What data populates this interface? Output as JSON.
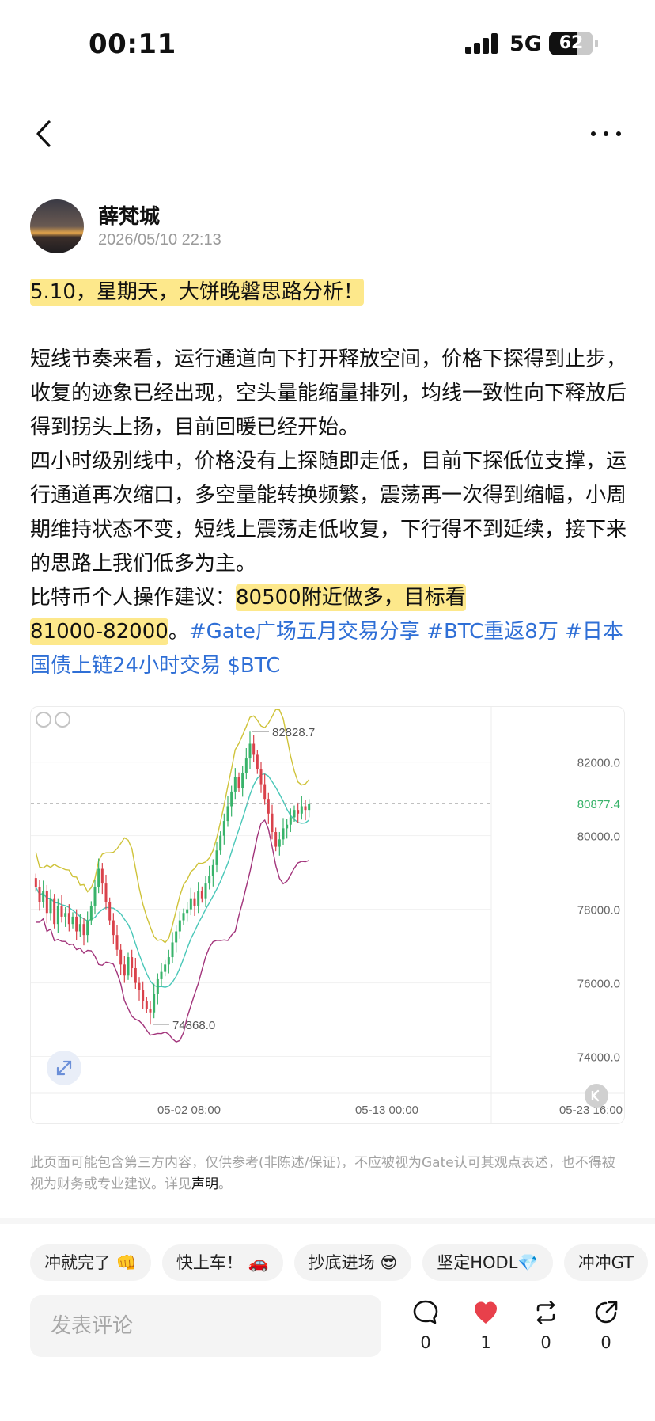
{
  "status": {
    "time": "00:11",
    "network": "5G",
    "battery": "62",
    "battery_level": 0.62
  },
  "post": {
    "author": "薛梵城",
    "timestamp": "2026/05/10 22:13",
    "title": "5.10，星期天，大饼晚磐思路分析！",
    "para1": "短线节奏来看，运行通道向下打开释放空间，价格下探得到止步，收复的迹象已经出现，空头量能缩量排列，均线一致性向下释放后得到拐头上扬，目前回暖已经开始。",
    "para2": "四小时级别线中，价格没有上探随即走低，目前下探低位支撑，运行通道再次缩口，多空量能转换频繁，震荡再一次得到缩幅，小周期维持状态不变，短线上震荡走低收复，下行得不到延续，接下来的思路上我们低多为主。",
    "advice_prefix": "比特币个人操作建议：",
    "advice_highlight1": "80500附近做多，目标看",
    "advice_highlight2": "81000-82000",
    "advice_end": "。",
    "tags": [
      "#Gate广场五月交易分享",
      "#BTC重返8万",
      "#日本国债上链24小时交易",
      "$BTC"
    ]
  },
  "chart_data": {
    "type": "candlestick",
    "x_tick_labels": [
      "05-02 08:00",
      "05-13 00:00",
      "05-23 16:00"
    ],
    "y_tick_labels": [
      "82000.0",
      "80000.0",
      "78000.0",
      "76000.0",
      "74000.0"
    ],
    "ylim": [
      73000,
      83500
    ],
    "current_price": "80877.4",
    "high_label": "82828.7",
    "low_label": "74868.0",
    "high_value": 82828.7,
    "low_value": 74868.0,
    "current_value": 80877.4,
    "grid": true,
    "colors": {
      "up": "#38b36a",
      "down": "#d9424b",
      "upper_band": "#cfc33a",
      "mid_band": "#49c7b8",
      "lower_band": "#a2347b"
    },
    "closes": [
      78600,
      78200,
      78500,
      77900,
      78300,
      77600,
      78100,
      77800,
      77900,
      77600,
      77800,
      77400,
      77600,
      77300,
      77700,
      78100,
      78600,
      79100,
      78700,
      78200,
      77700,
      77300,
      76900,
      76500,
      76200,
      76700,
      76400,
      76000,
      75800,
      75500,
      75300,
      75200,
      75700,
      76100,
      76300,
      76500,
      76700,
      77100,
      77400,
      77700,
      77900,
      78000,
      78300,
      78100,
      78500,
      78300,
      78700,
      78900,
      79200,
      79600,
      80000,
      80400,
      80800,
      81200,
      81600,
      81300,
      81700,
      82100,
      82500,
      82200,
      81800,
      81400,
      81000,
      80600,
      80100,
      79700,
      79900,
      80200,
      80300,
      80500,
      80700,
      80600,
      80800,
      80700,
      80877
    ]
  },
  "disclaimer": {
    "text": "此页面可能包含第三方内容，仅供参考(非陈述/保证)，不应被视为Gate认可其观点表述，也不得被视为财务或专业建议。详见",
    "link": "声明",
    "end": "。"
  },
  "reactions": [
    "冲就完了 👊",
    "快上车！ 🚗",
    "抄底进场 😎",
    "坚定HODL💎",
    "冲冲GT"
  ],
  "comment": {
    "placeholder": "发表评论"
  },
  "actions": {
    "comments": "0",
    "likes": "1",
    "reposts": "0",
    "shares": "0",
    "like_color": "#e8404b"
  }
}
